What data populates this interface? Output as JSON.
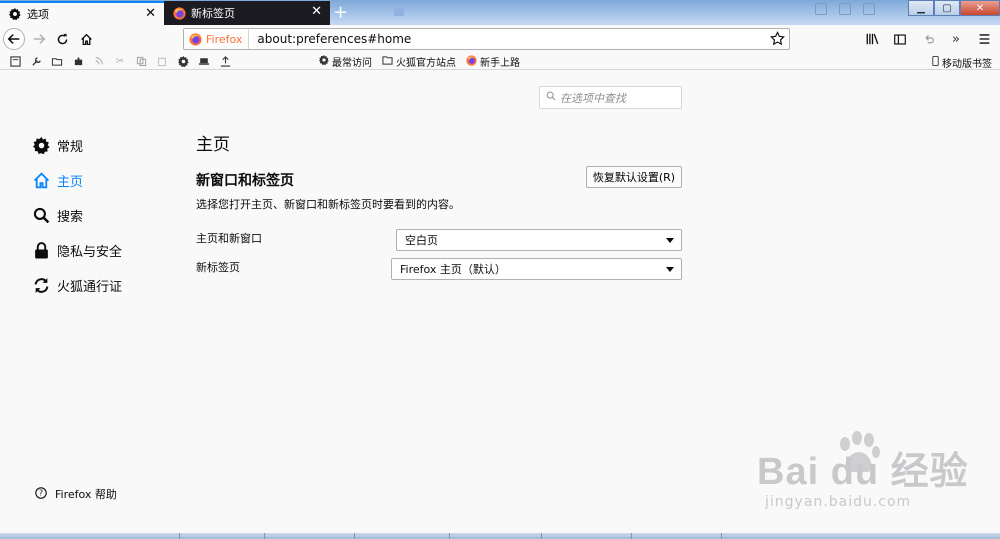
{
  "tabs": [
    {
      "label": "选项",
      "icon": "gear-icon",
      "active": true
    },
    {
      "label": "新标签页",
      "icon": "firefox-icon",
      "active": false
    }
  ],
  "newtab_symbol": "+",
  "urlbar": {
    "identity": "Firefox",
    "url": "about:preferences#home"
  },
  "bookmarks": [
    {
      "label": "最常访问",
      "icon": "gear-icon"
    },
    {
      "label": "火狐官方站点",
      "icon": "folder-icon"
    },
    {
      "label": "新手上路",
      "icon": "firefox-icon"
    }
  ],
  "mobile_bookmarks": "移动版书签",
  "search": {
    "placeholder": "在选项中查找"
  },
  "sidebar": {
    "items": [
      {
        "label": "常规",
        "icon": "gear-icon"
      },
      {
        "label": "主页",
        "icon": "home-icon",
        "selected": true
      },
      {
        "label": "搜索",
        "icon": "search-icon"
      },
      {
        "label": "隐私与安全",
        "icon": "lock-icon"
      },
      {
        "label": "火狐通行证",
        "icon": "sync-icon"
      }
    ]
  },
  "help": {
    "label": "Firefox 帮助"
  },
  "main": {
    "title": "主页",
    "section_title": "新窗口和标签页",
    "restore_button": "恢复默认设置(R)",
    "description": "选择您打开主页、新窗口和新标签页时要看到的内容。",
    "rows": [
      {
        "label": "主页和新窗口",
        "value": "空白页"
      },
      {
        "label": "新标签页",
        "value": "Firefox 主页（默认）"
      }
    ]
  },
  "watermark": {
    "main": "Bai du 经验",
    "sub": "jingyan.baidu.com"
  },
  "colors": {
    "accent": "#0a84ff",
    "tab_dark": "#1c1b22",
    "firefox_orange": "#ff7139"
  }
}
